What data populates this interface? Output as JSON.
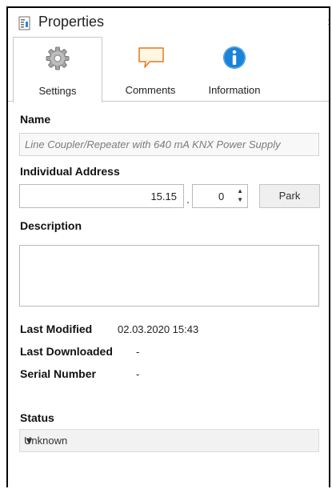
{
  "header": {
    "title": "Properties",
    "chevron": "›",
    "icon": "properties-document-icon"
  },
  "tabs": [
    {
      "label": "Settings",
      "icon": "gear-icon",
      "selected": true
    },
    {
      "label": "Comments",
      "icon": "speech-bubble-icon",
      "selected": false
    },
    {
      "label": "Information",
      "icon": "info-icon",
      "selected": false
    }
  ],
  "name": {
    "label": "Name",
    "value": "Line Coupler/Repeater with 640 mA KNX Power Supply"
  },
  "individual_address": {
    "label": "Individual Address",
    "line_value": "15.15",
    "separator": ".",
    "device_value": "0",
    "park_label": "Park"
  },
  "description": {
    "label": "Description",
    "value": ""
  },
  "info": {
    "last_modified_label": "Last Modified",
    "last_modified_value": "02.03.2020 15:43",
    "last_downloaded_label": "Last Downloaded",
    "last_downloaded_value": "-",
    "serial_number_label": "Serial Number",
    "serial_number_value": "-"
  },
  "status": {
    "label": "Status",
    "selected": "Unknown"
  },
  "colors": {
    "info_blue": "#1a82d8",
    "comment_orange": "#e07a1f",
    "comment_fill": "#fff6e3",
    "gear_gray": "#9a9a9a"
  }
}
